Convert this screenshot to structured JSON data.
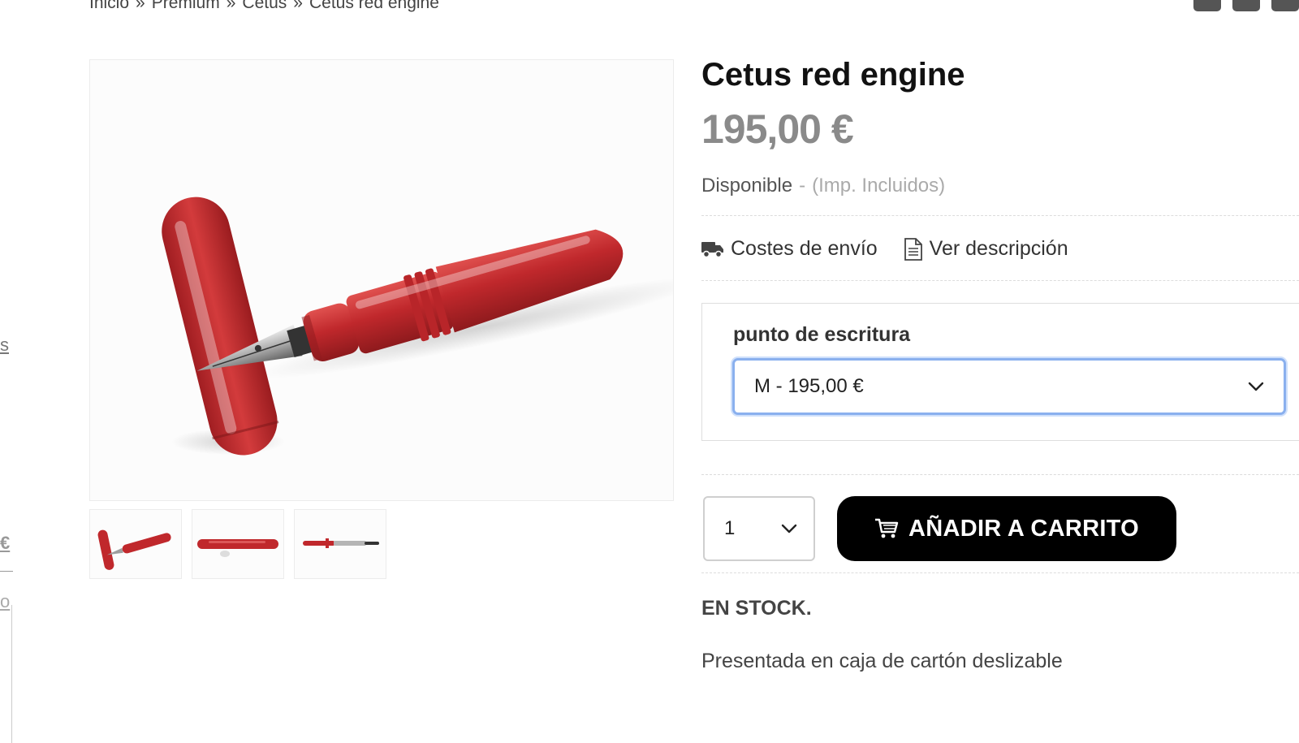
{
  "breadcrumb": {
    "items": [
      "Inicio",
      "Premium",
      "Cetus",
      "Cetus red engine"
    ],
    "separator": "»"
  },
  "sidebar_fragments": {
    "link_s": "s",
    "price_tail": "€",
    "other_tail": "o"
  },
  "gallery": {
    "main_image": "red-fountain-pen-image",
    "thumbnails": [
      "pen-thumbnail-1",
      "pen-thumbnail-2",
      "pen-thumbnail-3"
    ]
  },
  "product": {
    "title": "Cetus red engine",
    "price": "195,00 €",
    "availability": "Disponible",
    "separator": "-",
    "tax_note": "(Imp. Incluidos)",
    "shipping_link": "Costes de envío",
    "description_link": "Ver descripción",
    "option_label": "punto de escritura",
    "option_selected": "M - 195,00 €",
    "quantity": "1",
    "add_to_cart": "AÑADIR A CARRITO",
    "stock": "EN STOCK.",
    "note": "Presentada en caja de cartón deslizable"
  },
  "colors": {
    "accent_button": "#000000",
    "price_color": "#8a8a8a",
    "select_focus": "#8ab0ee",
    "pen_red": "#c0282c"
  }
}
